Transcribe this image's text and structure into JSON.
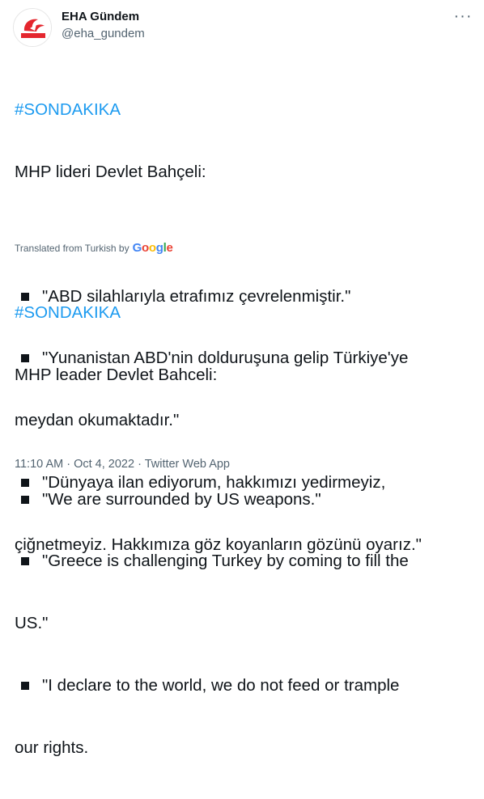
{
  "author": {
    "display_name": "EHA Gündem",
    "handle": "@eha_gundem",
    "avatar_text": "EHA GÜNDEM"
  },
  "original": {
    "hashtag": "#SONDAKIKA",
    "intro": "MHP lideri Devlet Bahçeli:",
    "bullets": [
      [
        "\"ABD silahlarıyla etrafımız çevrelenmiştir.\""
      ],
      [
        "\"Yunanistan ABD'nin dolduruşuna gelip Türkiye'ye",
        "meydan okumaktadır.\""
      ],
      [
        "\"Dünyaya ilan ediyorum, hakkımızı yedirmeyiz,",
        "çiğnetmeyiz. Hakkımıza göz koyanların gözünü oyarız.\""
      ]
    ]
  },
  "translation": {
    "label": "Translated from Turkish by",
    "provider": "Google"
  },
  "translated": {
    "hashtag": "#SONDAKIKA",
    "intro": "MHP leader Devlet Bahceli:",
    "bullets": [
      [
        "\"We are surrounded by US weapons.\""
      ],
      [
        "\"Greece is challenging Turkey by coming to fill the",
        "US.\""
      ],
      [
        "\"I declare to the world, we do not feed or trample",
        "our rights."
      ]
    ]
  },
  "meta": {
    "time": "11:10 AM",
    "separator": " · ",
    "date": "Oct 4, 2022",
    "source": "Twitter Web App"
  },
  "colors": {
    "link": "#1d9bf0",
    "text": "#0f1419",
    "secondary": "#536471",
    "logo_red": "#e4262e"
  },
  "icons": {
    "more": "more-horizontal-icon",
    "bullet": "black-square-icon"
  }
}
